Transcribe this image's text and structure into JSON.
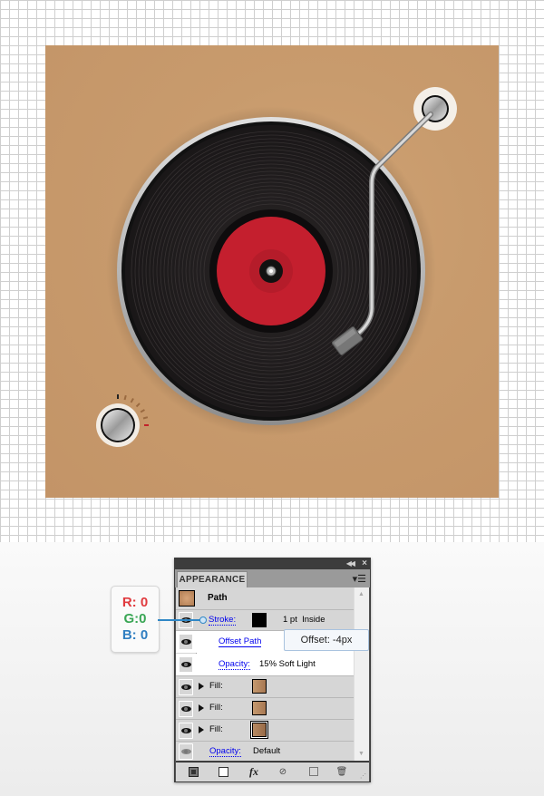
{
  "canvas": {
    "background_color": "#c69a6c",
    "record_label_color": "#c41f2e",
    "volume_indicator_color": "#c2212a"
  },
  "rgb_callout": {
    "r": "R: 0",
    "g": "G:0",
    "b": "B: 0",
    "r_color": "#e03a3e",
    "g_color": "#3aa655",
    "b_color": "#2f7ec1"
  },
  "tooltip": {
    "text": "Offset: -4px"
  },
  "panel": {
    "tab_label": "APPEARANCE",
    "object_label": "Path",
    "rows": [
      {
        "type": "stroke",
        "label": "Stroke:",
        "value": "1 pt  Inside",
        "swatch_color": "#000000"
      },
      {
        "type": "effect",
        "label": "Offset Path"
      },
      {
        "type": "opacity",
        "label": "Opacity:",
        "value": "15% Soft Light"
      },
      {
        "type": "fill",
        "label": "Fill:",
        "swatch_color": "#b8875f"
      },
      {
        "type": "fill",
        "label": "Fill:",
        "swatch_color": "#b8875f"
      },
      {
        "type": "fill",
        "label": "Fill:",
        "swatch_color": "#a97a55"
      },
      {
        "type": "opacity",
        "label": "Opacity:",
        "value": "Default"
      }
    ],
    "footer_icons": [
      "add-stroke-icon",
      "add-fill-icon",
      "fx-icon",
      "clear-appearance-icon",
      "duplicate-item-icon",
      "delete-item-icon"
    ],
    "fx_label": "fx"
  }
}
